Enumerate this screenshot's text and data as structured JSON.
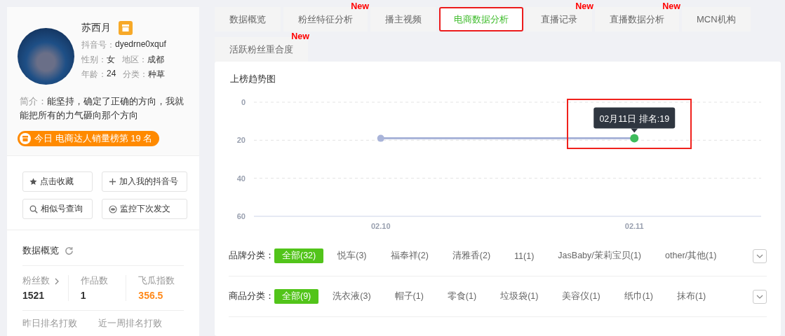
{
  "profile": {
    "name": "苏西月",
    "fields": [
      {
        "label": "抖音号：",
        "value": "dyedrne0xquf"
      },
      {
        "label": "性别：",
        "value": "女"
      },
      {
        "label": "地区：",
        "value": "成都"
      },
      {
        "label": "年龄：",
        "value": "24"
      },
      {
        "label": "分类：",
        "value": "种草"
      }
    ],
    "bio_label": "简介：",
    "bio": "能坚持，确定了正确的方向，我就能把所有的力气砸向那个方向",
    "rank_badge": "今日 电商达人销量榜第 19 名"
  },
  "actions": [
    {
      "kind": "star",
      "label": "点击收藏"
    },
    {
      "kind": "plus",
      "label": "加入我的抖音号"
    },
    {
      "kind": "search",
      "label": "相似号查询"
    },
    {
      "kind": "eye",
      "label": "监控下次发文"
    }
  ],
  "overview": {
    "title": "数据概览",
    "stats": [
      {
        "label": "粉丝数",
        "link": true,
        "value": "1521",
        "highlight": false
      },
      {
        "label": "作品数",
        "link": false,
        "value": "1",
        "highlight": false
      },
      {
        "label": "飞瓜指数",
        "link": false,
        "value": "356.5",
        "highlight": true
      }
    ],
    "more": [
      "昨日排名打败",
      "近一周排名打败"
    ]
  },
  "tabs": [
    {
      "label": "数据概览",
      "selected": false
    },
    {
      "label": "粉丝特征分析",
      "selected": false,
      "badge": "New"
    },
    {
      "label": "播主视频",
      "selected": false
    },
    {
      "label": "电商数据分析",
      "selected": true
    },
    {
      "label": "直播记录",
      "selected": false,
      "badge": "New"
    },
    {
      "label": "直播数据分析",
      "selected": false,
      "badge": "New"
    },
    {
      "label": "MCN机构",
      "selected": false
    },
    {
      "label": "活跃粉丝重合度",
      "selected": false,
      "badge": "New"
    }
  ],
  "trend": {
    "title": "上榜趋势图",
    "chart_data": {
      "type": "line",
      "categories": [
        "02.10",
        "02.11"
      ],
      "series": [
        {
          "color": "#a9b4d9",
          "marker": "circle",
          "values": [
            19,
            19
          ]
        }
      ],
      "ylim": [
        60,
        0
      ],
      "yticks": [
        0,
        20,
        40,
        60
      ],
      "annotations": [
        "02月11日 排名:19"
      ]
    }
  },
  "filters": [
    {
      "label": "品牌分类：",
      "options": [
        {
          "label": "全部(32)",
          "selected": true
        },
        {
          "label": "悦车(3)",
          "selected": false
        },
        {
          "label": "福奉祥(2)",
          "selected": false
        },
        {
          "label": "清雅香(2)",
          "selected": false
        },
        {
          "label": "11(1)",
          "selected": false
        },
        {
          "label": "JasBaby/茉莉宝贝(1)",
          "selected": false
        },
        {
          "label": "other/其他(1)",
          "selected": false
        }
      ]
    },
    {
      "label": "商品分类：",
      "options": [
        {
          "label": "全部(9)",
          "selected": true
        },
        {
          "label": "洗衣液(3)",
          "selected": false
        },
        {
          "label": "帽子(1)",
          "selected": false
        },
        {
          "label": "零食(1)",
          "selected": false
        },
        {
          "label": "垃圾袋(1)",
          "selected": false
        },
        {
          "label": "美容仪(1)",
          "selected": false
        },
        {
          "label": "纸巾(1)",
          "selected": false
        },
        {
          "label": "抹布(1)",
          "selected": false
        }
      ]
    }
  ]
}
